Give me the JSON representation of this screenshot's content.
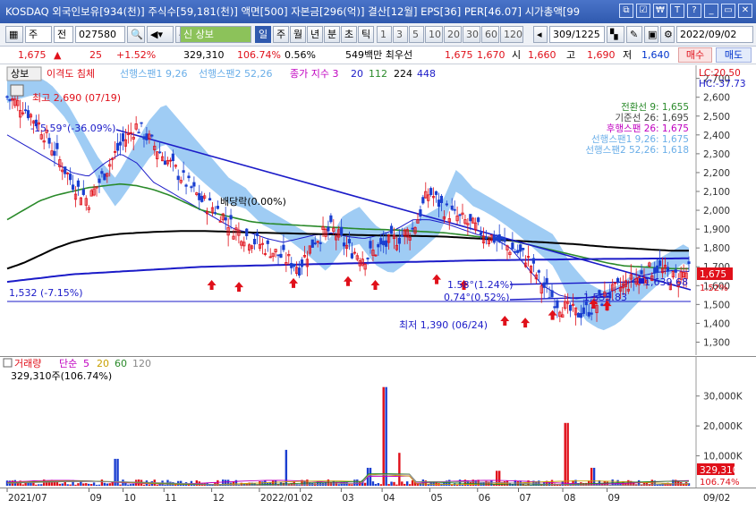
{
  "window": {
    "title": "KOSDAQ 외국인보유[934(천)] 주식수[59,181(천)] 액면[500] 자본금[296(억)] 결산[12월] EPS[36] PER[46.07] 시가총액[99",
    "buttons": [
      "⧉",
      "☑",
      "₩",
      "T",
      "?",
      "",
      "▭",
      "✕"
    ]
  },
  "toolbar": {
    "market": "주",
    "stock_type": "전",
    "code": "027580",
    "stock_name": "상보",
    "periods": [
      "일",
      "주",
      "월",
      "년",
      "분",
      "초",
      "틱"
    ],
    "active_period": "일",
    "intervals": [
      "1",
      "3",
      "5",
      "10",
      "20",
      "30",
      "60",
      "120"
    ],
    "counter": "309/1225",
    "date": "2022/09/02",
    "buy_btn": "매수",
    "sell_btn": "매도"
  },
  "pricebar": {
    "price": "1,675",
    "change": "25",
    "change_pct": "+1.52%",
    "volume": "329,310",
    "vol_ratio": "106.74%",
    "vol_ratio_pct": "0.56%",
    "prev_label": "549백만 최우선",
    "ask": "1,675",
    "bid": "1,670",
    "open_label": "시",
    "open": "1,660",
    "high_label": "고",
    "high": "1,690",
    "low_label": "저",
    "low": "1,640"
  },
  "chart_data": [
    {
      "type": "candlestick",
      "title": "상보",
      "legend": [
        "이격도 침체",
        "선행스팬1 9,26",
        "선행스팬2 52,26",
        "종가 지수 3",
        "20",
        "112",
        "224",
        "448"
      ],
      "yticks": [
        2700,
        2600,
        2500,
        2400,
        2300,
        2200,
        2100,
        2000,
        1900,
        1800,
        1700,
        1600,
        1500,
        1400,
        1300
      ],
      "ylim": [
        1250,
        2760
      ],
      "lc": "LC:20.50",
      "hc": "HC:-37.73",
      "current_price": "1,675",
      "current_pct": "1.52%",
      "right_labels": [
        "전환선 9: 1,655",
        "기준선 26: 1,695",
        "후행스팬 26: 1,675",
        "선행스팬1 9,26: 1,675",
        "선행스팬2 52,26: 1,618"
      ],
      "annotations": {
        "high": "최고 2,690 (07/19)",
        "low": "최저 1,390 (06/24)",
        "dividend": "배당락(0.00%)",
        "trend1": "-15.59°(-36.09%)",
        "trend2": "1,532 (-7.15%)",
        "trend3": "1.58°(1.24%)",
        "trend4": "0.74°(0.52%)",
        "level1": "1,639.68",
        "level2": "1,555.83"
      },
      "series": [
        {
          "name": "종가",
          "values": [
            2600,
            2550,
            2450,
            2300,
            2150,
            2050,
            2200,
            2350,
            2450,
            2350,
            2250,
            2150,
            2050,
            2000,
            1900,
            1850,
            1800,
            1750,
            1700,
            1850,
            1900,
            1800,
            1750,
            1800,
            1850,
            1900,
            2100,
            2000,
            1950,
            1900,
            1850,
            1800,
            1750,
            1600,
            1500,
            1450,
            1480,
            1550,
            1600,
            1650,
            1700,
            1640,
            1675
          ]
        },
        {
          "name": "20",
          "values": [
            2400,
            2350,
            2300,
            2250,
            2200,
            2180,
            2250,
            2300,
            2250,
            2150,
            2100,
            2050,
            2000,
            1950,
            1900,
            1880,
            1850,
            1830,
            1850,
            1870,
            1880,
            1860,
            1850,
            1870,
            1900,
            1950,
            1950,
            1930,
            1900,
            1870,
            1850,
            1800,
            1700,
            1600,
            1550,
            1530,
            1540,
            1560,
            1600,
            1650,
            1670,
            1680,
            1675
          ]
        },
        {
          "name": "112",
          "values": [
            1950,
            2000,
            2050,
            2080,
            2100,
            2120,
            2130,
            2140,
            2130,
            2110,
            2080,
            2040,
            2000,
            1980,
            1960,
            1940,
            1930,
            1925,
            1920,
            1915,
            1910,
            1905,
            1900,
            1898,
            1895,
            1890,
            1885,
            1880,
            1870,
            1860,
            1850,
            1840,
            1820,
            1800,
            1780,
            1760,
            1740,
            1720,
            1705,
            1700,
            1695,
            1690,
            1690
          ]
        },
        {
          "name": "224",
          "values": [
            1690,
            1720,
            1760,
            1800,
            1830,
            1850,
            1865,
            1875,
            1880,
            1885,
            1888,
            1890,
            1890,
            1888,
            1885,
            1882,
            1880,
            1878,
            1876,
            1874,
            1872,
            1870,
            1868,
            1866,
            1865,
            1864,
            1862,
            1860,
            1855,
            1850,
            1845,
            1840,
            1835,
            1830,
            1825,
            1820,
            1812,
            1805,
            1800,
            1795,
            1790,
            1785,
            1785
          ]
        },
        {
          "name": "448",
          "values": [
            1620,
            1630,
            1640,
            1650,
            1660,
            1665,
            1670,
            1675,
            1680,
            1685,
            1690,
            1695,
            1700,
            1702,
            1704,
            1706,
            1708,
            1710,
            1712,
            1714,
            1716,
            1718,
            1720,
            1722,
            1724,
            1726,
            1728,
            1730,
            1732,
            1734,
            1735,
            1736,
            1737,
            1738,
            1739,
            1740,
            1741,
            1742,
            1742,
            1743,
            1744,
            1744,
            1745
          ]
        }
      ]
    },
    {
      "type": "bar",
      "title": "거래량",
      "legend": [
        "거래량",
        "단순",
        "5",
        "20",
        "60",
        "120"
      ],
      "current": "329,310주(106.74%)",
      "yticks": [
        "30,000K",
        "20,000K",
        "10,000K"
      ],
      "current_value": "329,310",
      "current_ratio": "106.74%",
      "ylim": [
        0,
        35000
      ]
    }
  ],
  "xaxis": {
    "labels": [
      "2021/07",
      "09",
      "10",
      "11",
      "12",
      "2022/01",
      "02",
      "03",
      "04",
      "05",
      "06",
      "07",
      "08",
      "09"
    ],
    "right": "09/02"
  }
}
